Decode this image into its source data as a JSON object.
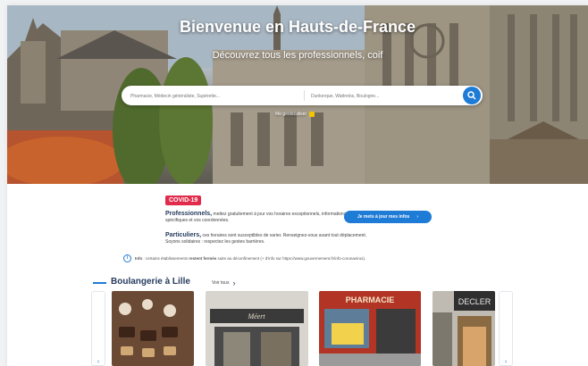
{
  "hero": {
    "title": "Bienvenue en Hauts-de-France",
    "subtitle": "Découvrez tous les professionnels, coif",
    "search_placeholder": "Pharmacie, Médecin généraliste, Supérette...",
    "location_placeholder": "Dunkerque, Wattrelos, Boulogne...",
    "geo_label": "Me géolocaliser"
  },
  "covid": {
    "badge": "COVID-19",
    "pro_title": "Professionnels,",
    "pro_text": " mettez gratuitement à jour vos horaires exceptionnels, informations spécifiques et vos coordonnées.",
    "part_title": "Particuliers,",
    "part_text": " ces horaires sont susceptibles de varier. Renseignez-vous avant tout déplacement. Soyons solidaires : respectez les gestes barrières.",
    "button": "Je mets à jour mes infos",
    "info_prefix": "Info",
    "info_mid": " : certains établissements ",
    "info_bold": "restent fermés",
    "info_suffix": " suite au déconfinement (+ d'info sur https://www.gouvernement.fr/info-coronavirus)."
  },
  "section": {
    "title": "Boulangerie à Lille",
    "see_all": "Voir tous",
    "cards": [
      {
        "name": "bakery-pastries-photo"
      },
      {
        "name": "bakery-storefront-photo",
        "sign": "Méert"
      },
      {
        "name": "pharmacy-storefront-photo",
        "sign": "PHARMACIE"
      },
      {
        "name": "decler-storefront-photo",
        "sign": "DECLER"
      }
    ]
  },
  "colors": {
    "accent": "#1e7bd6",
    "covid": "#e22b4b",
    "heading": "#263b5e"
  },
  "icons": {
    "search": "search-icon",
    "location": "location-pin-icon",
    "info": "info-icon",
    "chevron_right": "chevron-right-icon",
    "chevron_left": "chevron-left-icon"
  }
}
